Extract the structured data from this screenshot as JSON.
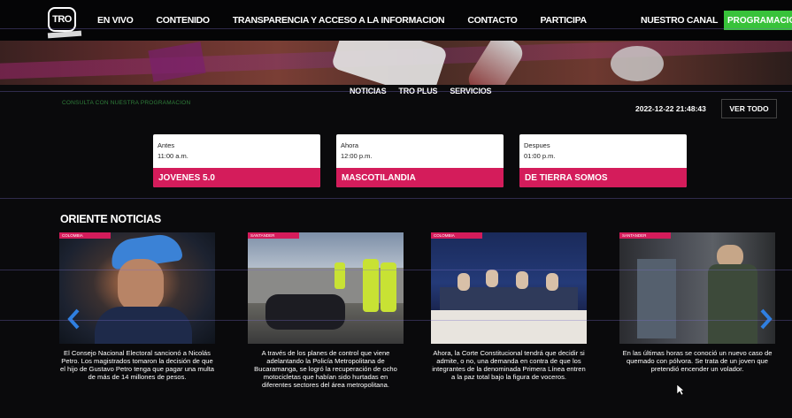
{
  "header": {
    "logo_text": "TRO",
    "nav": [
      "EN VIVO",
      "CONTENIDO",
      "TRANSPARENCIA Y ACCESO A LA INFORMACION",
      "CONTACTO",
      "PARTICIPA"
    ],
    "canal_label": "NUESTRO CANAL",
    "programacion_label": "PROGRAMACION"
  },
  "subnav": [
    "NOTICIAS",
    "TRO PLUS",
    "SERVICIOS"
  ],
  "schedule_note": "CONSULTA CON NUESTRA PROGRAMACION",
  "timestamp": "2022-12-22 21:48:43",
  "ver_todo_label": "VER TODO",
  "schedule": [
    {
      "when": "Antes",
      "time": "11:00 a.m.",
      "show": "JOVENES 5.0"
    },
    {
      "when": "Ahora",
      "time": "12:00 p.m.",
      "show": "MASCOTILANDIA"
    },
    {
      "when": "Despues",
      "time": "01:00 p.m.",
      "show": "DE TIERRA SOMOS"
    }
  ],
  "news_section_title": "ORIENTE NOTICIAS",
  "news": [
    {
      "badge": "COLOMBIA",
      "text": "El Consejo Nacional Electoral sancionó a Nicolás Petro. Los magistrados tomaron la decisión de que el hijo de Gustavo Petro tenga que pagar una multa de más de 14 millones de pesos."
    },
    {
      "badge": "SANTANDER",
      "text": "A través de los planes de control que viene adelantando la Policía Metropolitana de Bucaramanga, se logró la recuperación de ocho motocicletas que habían sido hurtadas en diferentes sectores del área metropolitana."
    },
    {
      "badge": "COLOMBIA",
      "text": "Ahora, la Corte Constitucional tendrá que decidir si admite, o no, una demanda en contra de que los integrantes de la denominada Primera Línea entren a la paz total bajo la figura de voceros."
    },
    {
      "badge": "SANTANDER",
      "text": "En las últimas horas se conoció un nuevo caso de quemado con pólvora. Se trata de un joven que pretendió encender un volador."
    }
  ],
  "colors": {
    "accent_pink": "#d41c5b",
    "accent_green": "#38c23a",
    "background": "#0a0a0c",
    "arrow_blue": "#2f7fe0"
  }
}
